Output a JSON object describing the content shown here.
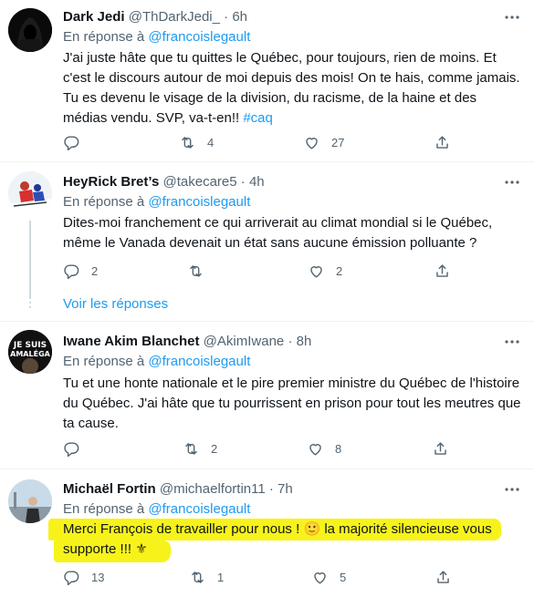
{
  "reply_prefix": "En réponse à",
  "tweets": [
    {
      "name": "Dark Jedi",
      "handle": "@ThDarkJedi_",
      "sep": "·",
      "time": "6h",
      "reply_to": "@francoislegault",
      "text": "J'ai juste hâte que tu quittes le Québec, pour toujours, rien de moins. Et c'est le discours autour de moi depuis des mois! On te hais, comme jamais. Tu es devenu le visage de la division, du racisme, de la haine et des médias vendu. SVP, va-t-en!!",
      "hashtag": "#caq",
      "replies": "",
      "retweets": "4",
      "likes": "27"
    },
    {
      "name": "HeyRick Bret’s",
      "handle": "@takecare5",
      "sep": "·",
      "time": "4h",
      "reply_to": "@francoislegault",
      "text": "Dites-moi franchement ce qui arriverait au climat mondial si le Québec, même le Vanada devenait un état sans aucune émission polluante ?",
      "replies": "2",
      "retweets": "",
      "likes": "2",
      "show_replies": "Voir les réponses"
    },
    {
      "name": "Iwane Akim Blanchet",
      "handle": "@AkimIwane",
      "sep": "·",
      "time": "8h",
      "reply_to": "@francoislegault",
      "text": "Tu et une honte nationale et le pire premier ministre du Québec de l'histoire du Québec. J'ai hâte que tu pourrissent en prison pour tout les meutres que ta cause.",
      "avatar_text_1": "JE SUIS",
      "avatar_text_2": "AMALÉGA",
      "replies": "",
      "retweets": "2",
      "likes": "8"
    },
    {
      "name": "Michaël Fortin",
      "handle": "@michaelfortin11",
      "sep": "·",
      "time": "7h",
      "reply_to": "@francoislegault",
      "text_1": "Merci François de travailler pour nous !",
      "text_2": "la majorité silencieuse vous",
      "text_3": "supporte !!!",
      "emoji_smile": "🙂",
      "emoji_fleur": "⚜",
      "replies": "13",
      "retweets": "1",
      "likes": "5"
    }
  ],
  "colors": {
    "text": "#0f1419",
    "secondary": "#536471",
    "link": "#1d9bf0",
    "highlight": "#f7f31a",
    "border": "#eff3f4"
  }
}
